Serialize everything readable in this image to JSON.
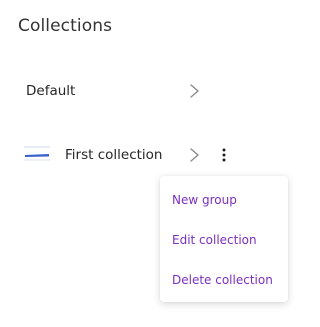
{
  "page": {
    "title": "Collections"
  },
  "collections": [
    {
      "label": "Default",
      "icon": "chevron-right-icon"
    },
    {
      "label": "First collection",
      "icon": "chevron-right-icon",
      "thumbnail": "collection-thumbnail",
      "more_icon": "more-vertical-icon"
    }
  ],
  "context_menu": {
    "items": [
      {
        "label": "New group"
      },
      {
        "label": "Edit collection"
      },
      {
        "label": "Delete collection"
      }
    ]
  },
  "colors": {
    "menu_text": "#7b2fbe",
    "thumbnail_accent": "#3a63c9"
  }
}
